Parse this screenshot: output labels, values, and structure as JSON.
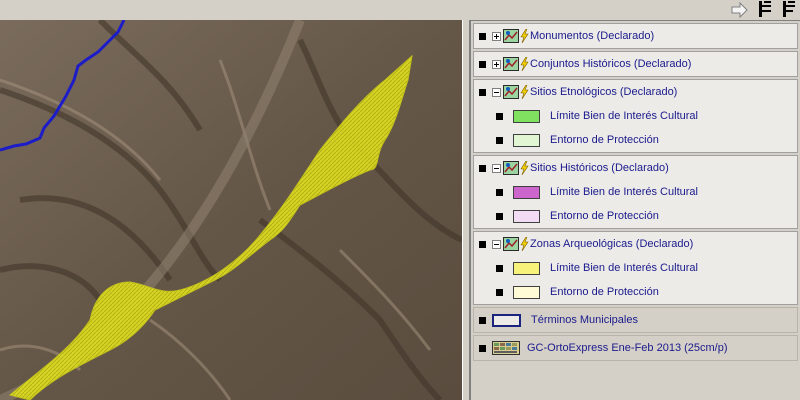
{
  "toolbar": {
    "buttons": [
      {
        "name": "arrow-right-icon"
      },
      {
        "name": "layer-list-icon"
      },
      {
        "name": "layer-list-alt-icon"
      }
    ]
  },
  "legend": {
    "groups": [
      {
        "label": "Monumentos (Declarado)",
        "expanded": false,
        "children": []
      },
      {
        "label": "Conjuntos Históricos (Declarado)",
        "expanded": false,
        "children": []
      },
      {
        "label": "Sitios Etnológicos (Declarado)",
        "expanded": true,
        "children": [
          {
            "label": "Límite Bien de Interés Cultural",
            "color": "#80e060"
          },
          {
            "label": "Entorno de Protección",
            "color": "#e2f6d4"
          }
        ]
      },
      {
        "label": "Sitios Históricos (Declarado)",
        "expanded": true,
        "children": [
          {
            "label": "Límite Bien de Interés Cultural",
            "color": "#cc66cc"
          },
          {
            "label": "Entorno de Protección",
            "color": "#f2dcf4"
          }
        ]
      },
      {
        "label": "Zonas Arqueológicas (Declarado)",
        "expanded": true,
        "children": [
          {
            "label": "Límite Bien de Interés Cultural",
            "color": "#f6f27a"
          },
          {
            "label": "Entorno de Protección",
            "color": "#fefbd6"
          }
        ]
      }
    ],
    "municipal": {
      "label": "Términos Municipales",
      "color": "#1a237e"
    },
    "ortho": {
      "label": "GC-OrtoExpress Ene-Feb 2013 (25cm/p)"
    }
  },
  "colors": {
    "protected_zone": "#e0e020",
    "boundary_line": "#1c1cc8",
    "legend_text": "#1a1a8c"
  }
}
